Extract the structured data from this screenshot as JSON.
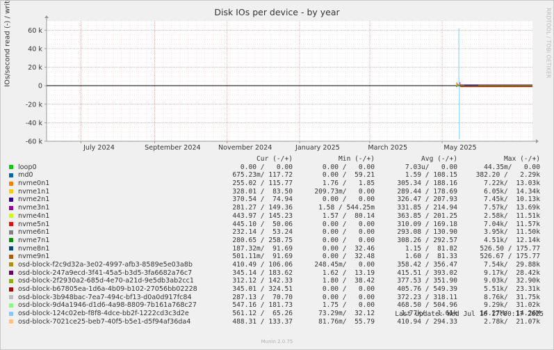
{
  "title": "Disk IOs per device - by year",
  "ylabel": "IOs/second read (-) / write (+)",
  "side_text": "RRDTOOL / TOBI OETIKER",
  "chart_data": {
    "type": "line",
    "yticks": [
      {
        "label": "60 k",
        "value": 60000
      },
      {
        "label": "40 k",
        "value": 40000
      },
      {
        "label": "20 k",
        "value": 20000
      },
      {
        "label": "0",
        "value": 0
      },
      {
        "label": "-20 k",
        "value": -20000
      },
      {
        "label": "-40 k",
        "value": -40000
      },
      {
        "label": "-60 k",
        "value": -60000
      }
    ],
    "ylim": [
      -60000,
      70000
    ],
    "x_start": "2024-06-02",
    "x_end": "2025-07-16",
    "xticks": [
      {
        "label": "July 2024",
        "date": "2024-07-01"
      },
      {
        "label": "September 2024",
        "date": "2024-09-01"
      },
      {
        "label": "November 2024",
        "date": "2024-11-01"
      },
      {
        "label": "January 2025",
        "date": "2025-01-01"
      },
      {
        "label": "March 2025",
        "date": "2025-03-01"
      },
      {
        "label": "May 2025",
        "date": "2025-05-01"
      }
    ],
    "grid": true,
    "spike": {
      "date": "2025-05-15",
      "write": 62000,
      "read": -58000
    }
  },
  "legend": {
    "headers": {
      "cur": "Cur (-/+)",
      "min": "Min (-/+)",
      "avg": "Avg (-/+)",
      "max": "Max (-/+)"
    },
    "rows": [
      {
        "name": "loop0",
        "color": "#00cc00",
        "cur": "0.00 /   0.00",
        "min": "0.00 /   0.00",
        "avg": "7.03u/   0.00",
        "max": "44.35m/   0.00"
      },
      {
        "name": "md0",
        "color": "#0066b3",
        "cur": "675.23m/ 117.72",
        "min": "0.00 /  59.21",
        "avg": "1.59 / 108.15",
        "max": "382.20 /   2.29k"
      },
      {
        "name": "nvme0n1",
        "color": "#ff8000",
        "cur": "255.02 / 115.77",
        "min": "1.76 /   1.85",
        "avg": "305.34 / 188.16",
        "max": "7.22k/  13.03k"
      },
      {
        "name": "nvme1n1",
        "color": "#ffcc00",
        "cur": "328.01 /  83.50",
        "min": "209.73m/   0.00",
        "avg": "289.44 / 178.69",
        "max": "6.05k/  14.34k"
      },
      {
        "name": "nvme2n1",
        "color": "#330099",
        "cur": "370.54 /  74.94",
        "min": "0.00 /   0.00",
        "avg": "326.47 / 207.93",
        "max": "7.45k/  10.13k"
      },
      {
        "name": "nvme3n1",
        "color": "#990099",
        "cur": "281.27 / 149.36",
        "min": "1.58 / 544.25m",
        "avg": "331.85 / 214.94",
        "max": "7.57k/  13.69k"
      },
      {
        "name": "nvme4n1",
        "color": "#ccff00",
        "cur": "443.97 / 145.23",
        "min": "1.57 /  80.14",
        "avg": "363.85 / 201.25",
        "max": "2.58k/  11.51k"
      },
      {
        "name": "nvme5n1",
        "color": "#ff0000",
        "cur": "445.10 /  50.06",
        "min": "0.00 /   0.00",
        "avg": "310.09 / 169.18",
        "max": "7.04k/  11.57k"
      },
      {
        "name": "nvme6n1",
        "color": "#808080",
        "cur": "232.14 /  53.24",
        "min": "0.00 /   0.00",
        "avg": "293.08 / 130.90",
        "max": "3.95k/  11.50k"
      },
      {
        "name": "nvme7n1",
        "color": "#008f00",
        "cur": "280.65 / 258.75",
        "min": "0.00 /   0.00",
        "avg": "308.26 / 292.57",
        "max": "4.51k/  12.14k"
      },
      {
        "name": "nvme8n1",
        "color": "#00487d",
        "cur": "187.32m/  91.69",
        "min": "0.00 /  32.46",
        "avg": "1.15 /  81.82",
        "max": "526.50 / 175.77"
      },
      {
        "name": "nvme9n1",
        "color": "#b35a00",
        "cur": "501.11m/  91.69",
        "min": "0.00 /  32.48",
        "avg": "1.60 /  81.33",
        "max": "526.67 / 175.77"
      },
      {
        "name": "osd-block-f2c9d32a-3e02-4997-afb3-8589e5e03a8b",
        "color": "#b38f00",
        "cur": "410.49 / 106.06",
        "min": "248.45m/   0.00",
        "avg": "358.42 / 356.47",
        "max": "7.54k/  29.88k"
      },
      {
        "name": "osd-block-247a9ecd-3f41-45a5-b3d5-3fa6682a76c7",
        "color": "#6b006b",
        "cur": "345.14 / 183.62",
        "min": "1.62 /  13.19",
        "avg": "415.51 / 393.02",
        "max": "9.17k/  28.42k"
      },
      {
        "name": "osd-block-2f2930a2-685d-4e70-a21d-9e5db3ab2cc1",
        "color": "#8fb300",
        "cur": "312.12 / 142.33",
        "min": "1.80 /  38.42",
        "avg": "377.53 / 351.90",
        "max": "9.03k/  32.90k"
      },
      {
        "name": "osd-block-b67805ea-1d6a-4b09-b102-27056bb02228",
        "color": "#b30000",
        "cur": "345.01 / 324.51",
        "min": "0.00 /   0.00",
        "avg": "405.76 / 549.39",
        "max": "5.51k/  23.31k"
      },
      {
        "name": "osd-block-3b948bac-7ea7-494c-bf13-d0a0d917fc84",
        "color": "#bebebe",
        "cur": "287.13 /  70.70",
        "min": "0.00 /   0.00",
        "avg": "372.23 / 318.11",
        "max": "8.76k/  31.75k"
      },
      {
        "name": "osd-block-9d4a1946-d1d6-4a98-8809-7b161a768c27",
        "color": "#80ff80",
        "cur": "547.16 / 181.73",
        "min": "1.75 /   0.00",
        "avg": "468.50 / 504.96",
        "max": "9.29k/  31.02k"
      },
      {
        "name": "osd-block-124c02eb-f8f8-4dce-bb2f-1222cd3c3d2e",
        "color": "#80c9ff",
        "cur": "561.12 /  65.26",
        "min": "73.29m/  32.12",
        "avg": "1.77k/   1.61k",
        "max": "14.27M/  14.26M"
      },
      {
        "name": "osd-block-7021ce25-beb7-40f5-b5e1-d5f94af36da4",
        "color": "#ffc080",
        "cur": "488.31 / 133.37",
        "min": "81.76m/  55.79",
        "avg": "410.94 / 294.33",
        "max": "2.78k/  21.07k"
      }
    ]
  },
  "last_update": "Last update: Wed Jul 16 17:00:17 2025",
  "footer": "Munin 2.0.75"
}
